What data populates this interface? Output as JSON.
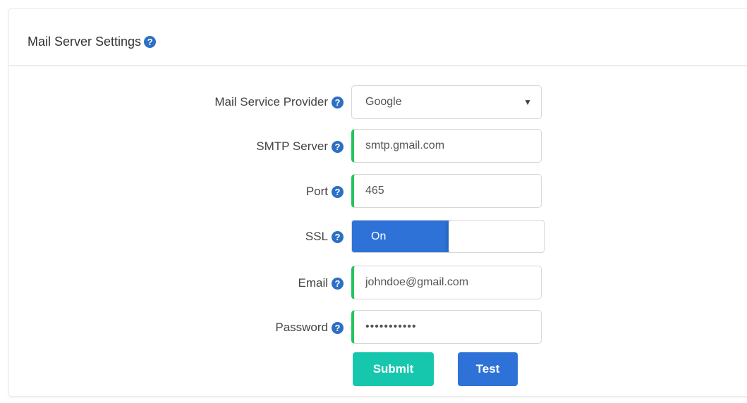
{
  "panel": {
    "title": "Mail Server Settings"
  },
  "help_icon_glyph": "?",
  "form": {
    "provider": {
      "label": "Mail Service Provider",
      "selected": "Google",
      "arrow": "▼"
    },
    "smtp_server": {
      "label": "SMTP Server",
      "value": "smtp.gmail.com"
    },
    "port": {
      "label": "Port",
      "value": "465"
    },
    "ssl": {
      "label": "SSL",
      "toggle_label": "On",
      "state": "on"
    },
    "email": {
      "label": "Email",
      "value": "johndoe@gmail.com"
    },
    "password": {
      "label": "Password",
      "value": "•••••••••••"
    }
  },
  "buttons": {
    "submit": "Submit",
    "test": "Test"
  },
  "colors": {
    "help_icon": "#2c6fc4",
    "valid_border": "#23c45a",
    "toggle_on": "#2e72d8",
    "submit_button": "#17c7ad",
    "test_button": "#2e72d8"
  }
}
